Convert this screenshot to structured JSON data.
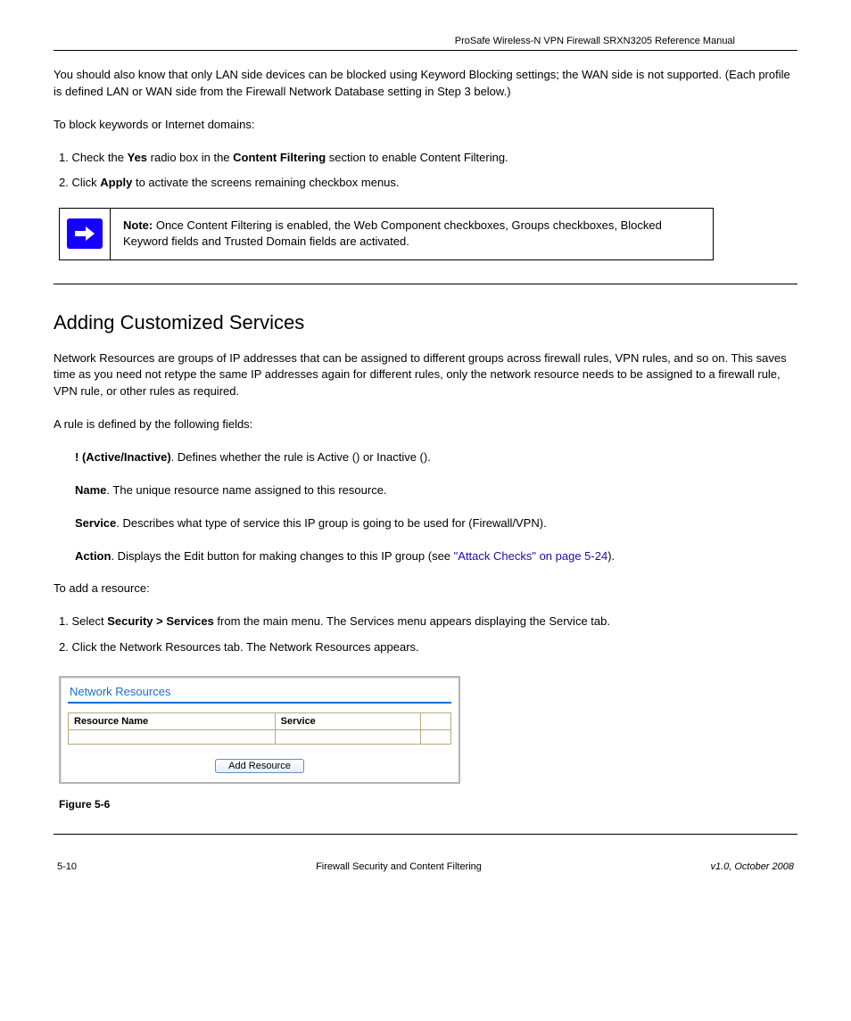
{
  "header_running": "ProSafe Wireless-N VPN Firewall SRXN3205 Reference Manual",
  "paragraphs": {
    "p1": "You should also know that only LAN side devices can be blocked using Keyword Blocking settings; the WAN side is not supported. (Each profile is defined LAN or WAN side from the Firewall Network Database setting in Step 3 below.)",
    "p2": "To block keywords or Internet domains:",
    "para_after_rule": "A rule is defined by the following fields:",
    "to_add_resource": "To add a resource:"
  },
  "num_items": {
    "it1a": "1. Check the ",
    "it1b": "Yes",
    "it1c": " radio box in the ",
    "it1d": "Content Filtering",
    "it1e": " section to enable Content Filtering.",
    "it2a": "2. Click ",
    "it2b": " to activate the screens remaining checkbox menus."
  },
  "note_label": "Note:",
  "note_text": " Once Content Filtering is enabled, the Web Component checkboxes, Groups checkboxes, Blocked Keyword fields and Trusted Domain fields are activated.",
  "section_title": "Adding Customized Services",
  "section_body_1": "Network Resources are groups of IP addresses that can be assigned to different groups across firewall rules, VPN rules, and so on. This saves time as you need not retype the same IP addresses again for different rules, only the network resource needs to be assigned to a firewall rule, VPN rule, or other rules as required.",
  "rule_fields": {
    "f1_label": "! (Active/Inactive)",
    "f1_text": ". Defines whether the rule is Active () or Inactive ().",
    "f2_label": "Name",
    "f2_text": ". The unique resource name assigned to this resource.",
    "f3_label": "Service",
    "f3_text": ". Describes what type of service this IP group is going to be used for (Firewall/VPN).",
    "f4_label": "Action",
    "f4_text": ". Displays the Edit button for making changes to this IP group (see ",
    "f4_link": "\"Attack Checks\" on page 5-24",
    "f4_after": ")."
  },
  "add_resource_steps": {
    "s1a": "1. Select ",
    "s1b": "Security > Services",
    "s1c": " from the main menu. The Services menu appears displaying the Service tab.",
    "s2a": "2. Click the Network Resources tab. The Network Resources appears."
  },
  "screenshot": {
    "title": "Network Resources",
    "col1": "Resource Name",
    "col2": "Service",
    "button": "Add Resource"
  },
  "figure_caption": "Figure 5-6",
  "footer": {
    "left": "5-10",
    "center": "Firewall Security and Content Filtering",
    "right": "v1.0, October 2008"
  },
  "apply_label": "Apply"
}
